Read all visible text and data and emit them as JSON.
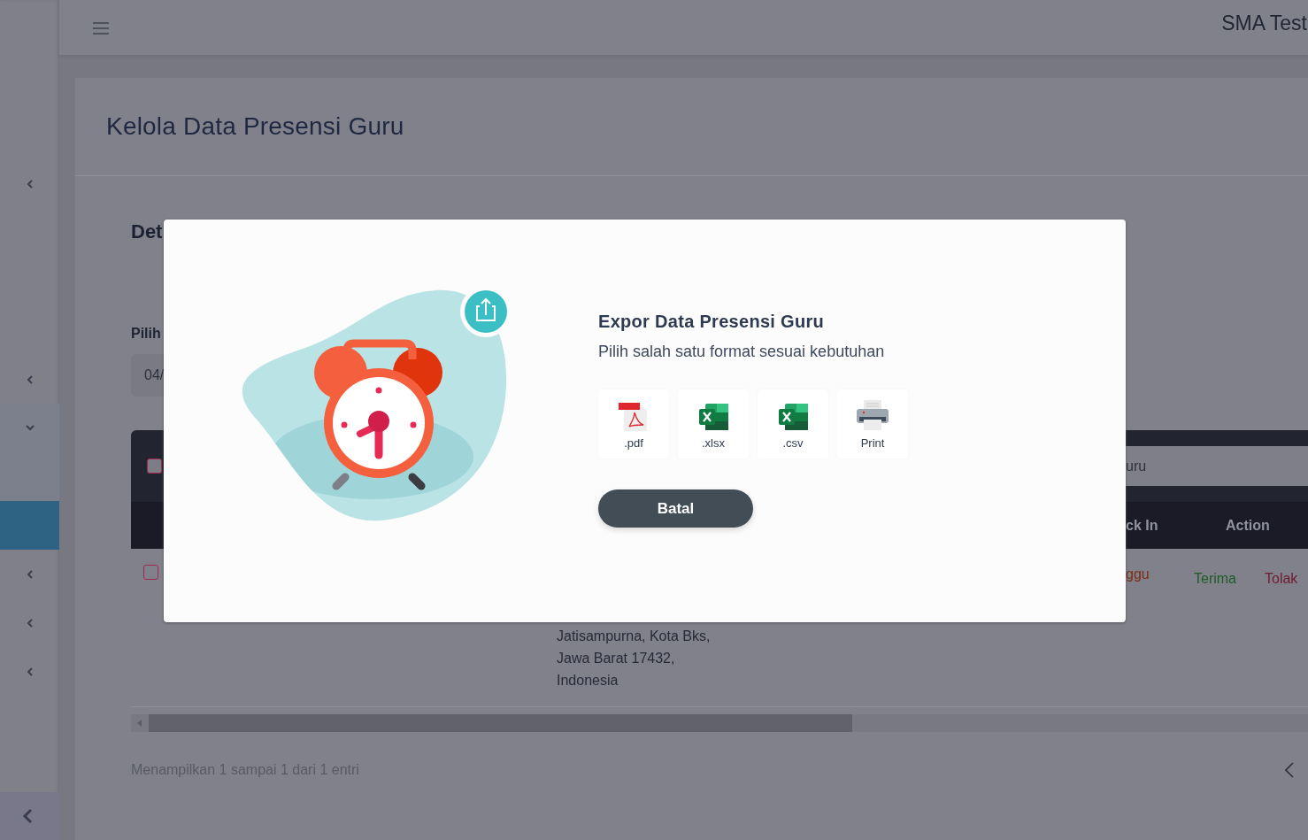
{
  "topbar": {
    "brand": "SMA Test"
  },
  "sidebar": {
    "items": [
      {
        "expanded": false
      },
      {
        "expanded": false
      },
      {
        "expanded": true,
        "children": [
          {
            "selected": true
          }
        ]
      },
      {
        "expanded": false
      },
      {
        "expanded": false
      },
      {
        "expanded": false
      }
    ]
  },
  "page": {
    "title": "Kelola Data Presensi Guru",
    "section_title": "Det",
    "filter_label": "Pilih",
    "date_field": {
      "value": "04/"
    }
  },
  "table": {
    "header_checkbox": {
      "checked": false
    },
    "search": {
      "placeholder": "uru"
    },
    "columns": [
      "ck In",
      "Action"
    ],
    "rows": [
      {
        "checked": false,
        "status": "ggu",
        "address": "Jatisampurna, Kota Bks,\nJawa Barat 17432,\nIndonesia",
        "actions": [
          {
            "label": "Terima",
            "kind": "accept"
          },
          {
            "label": "Tolak",
            "kind": "reject"
          }
        ]
      }
    ]
  },
  "footer": {
    "info": "Menampilkan 1 sampai 1 dari 1 entri"
  },
  "modal": {
    "title": "Expor Data Presensi Guru",
    "subtitle": "Pilih salah satu format sesuai kebutuhan",
    "options": [
      {
        "label": ".pdf",
        "kind": "pdf"
      },
      {
        "label": ".xlsx",
        "kind": "excel"
      },
      {
        "label": ".csv",
        "kind": "excel"
      },
      {
        "label": "Print",
        "kind": "print"
      }
    ],
    "cancel_button": "Batal"
  }
}
